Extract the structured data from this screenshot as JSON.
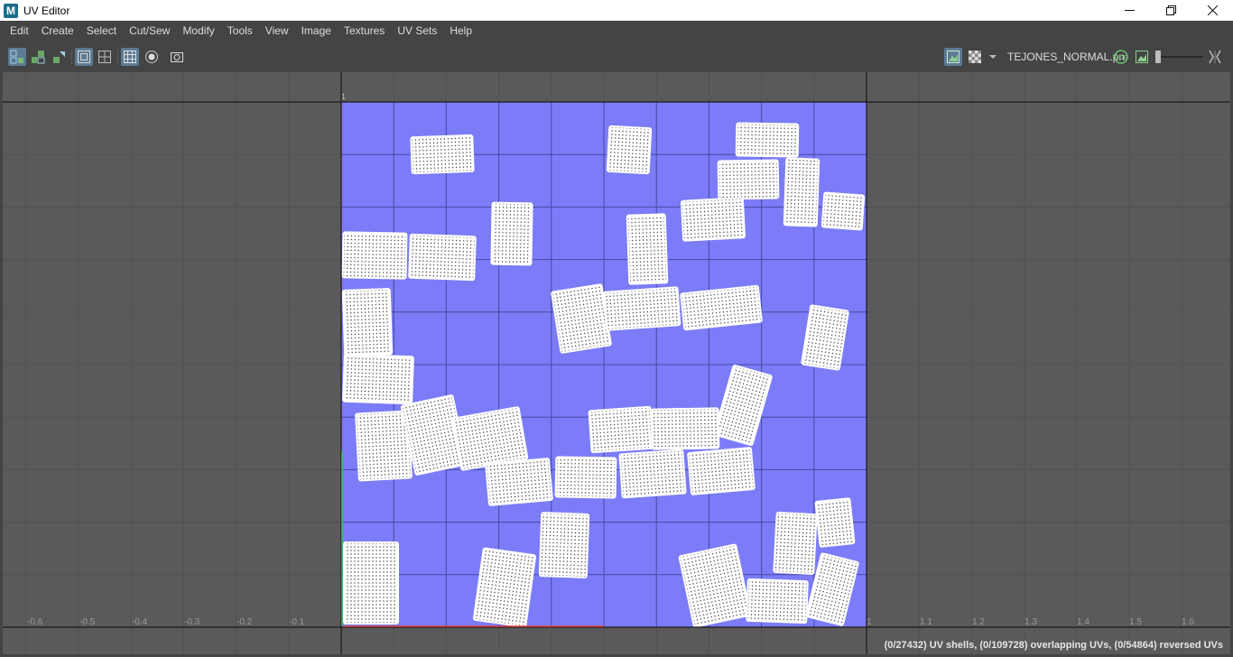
{
  "window": {
    "title": "UV Editor",
    "app_icon_letter": "M"
  },
  "menu": [
    "Edit",
    "Create",
    "Select",
    "Cut/Sew",
    "Modify",
    "Tools",
    "View",
    "Image",
    "Textures",
    "UV Sets",
    "Help"
  ],
  "toolbar": {
    "image_name": "TEJONES_NORMAL.pn",
    "left_icons": [
      "uv-shell-select-icon",
      "uv-layout-icon",
      "uv-flip-icon",
      "wireframe-toggle-icon",
      "grid-toggle-icon",
      "checker-grid-icon",
      "pin-dot-icon",
      "snapshot-icon"
    ],
    "right_icons": [
      "display-image-icon",
      "checker-pattern-icon",
      "dropdown-icon",
      "rgb-channels-icon",
      "image-ratio-icon",
      "exposure-slider",
      "expand-arrows-icon"
    ]
  },
  "viewport": {
    "corner_tick": "1",
    "axis_labels": [
      "-0.6",
      "-0.5",
      "-0.4",
      "-0.3",
      "-0.2",
      "-0.1",
      "1",
      "1.1",
      "1.2",
      "1.3",
      "1.4",
      "1.5",
      "1.6"
    ],
    "status": "(0/27432) UV shells, (0/109728) overlapping UVs, (0/54864) reversed UVs"
  },
  "colors": {
    "uv_tile": "#7c7cf8",
    "shell_fill": "#ffffff",
    "background": "#5a5a5a",
    "accent_active": "#5c7a94"
  }
}
